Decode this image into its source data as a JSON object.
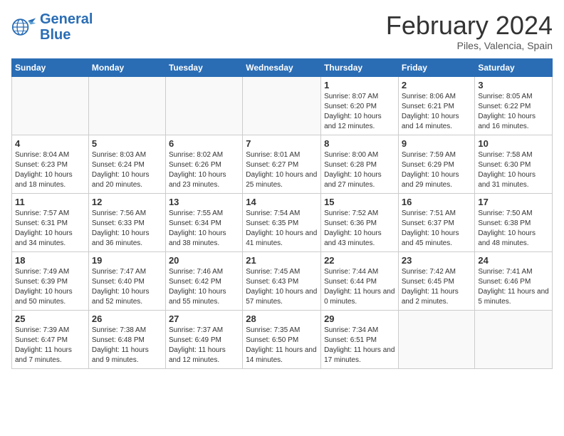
{
  "header": {
    "logo_line1": "General",
    "logo_line2": "Blue",
    "title": "February 2024",
    "subtitle": "Piles, Valencia, Spain"
  },
  "weekdays": [
    "Sunday",
    "Monday",
    "Tuesday",
    "Wednesday",
    "Thursday",
    "Friday",
    "Saturday"
  ],
  "weeks": [
    [
      {
        "day": "",
        "info": ""
      },
      {
        "day": "",
        "info": ""
      },
      {
        "day": "",
        "info": ""
      },
      {
        "day": "",
        "info": ""
      },
      {
        "day": "1",
        "info": "Sunrise: 8:07 AM\nSunset: 6:20 PM\nDaylight: 10 hours\nand 12 minutes."
      },
      {
        "day": "2",
        "info": "Sunrise: 8:06 AM\nSunset: 6:21 PM\nDaylight: 10 hours\nand 14 minutes."
      },
      {
        "day": "3",
        "info": "Sunrise: 8:05 AM\nSunset: 6:22 PM\nDaylight: 10 hours\nand 16 minutes."
      }
    ],
    [
      {
        "day": "4",
        "info": "Sunrise: 8:04 AM\nSunset: 6:23 PM\nDaylight: 10 hours\nand 18 minutes."
      },
      {
        "day": "5",
        "info": "Sunrise: 8:03 AM\nSunset: 6:24 PM\nDaylight: 10 hours\nand 20 minutes."
      },
      {
        "day": "6",
        "info": "Sunrise: 8:02 AM\nSunset: 6:26 PM\nDaylight: 10 hours\nand 23 minutes."
      },
      {
        "day": "7",
        "info": "Sunrise: 8:01 AM\nSunset: 6:27 PM\nDaylight: 10 hours\nand 25 minutes."
      },
      {
        "day": "8",
        "info": "Sunrise: 8:00 AM\nSunset: 6:28 PM\nDaylight: 10 hours\nand 27 minutes."
      },
      {
        "day": "9",
        "info": "Sunrise: 7:59 AM\nSunset: 6:29 PM\nDaylight: 10 hours\nand 29 minutes."
      },
      {
        "day": "10",
        "info": "Sunrise: 7:58 AM\nSunset: 6:30 PM\nDaylight: 10 hours\nand 31 minutes."
      }
    ],
    [
      {
        "day": "11",
        "info": "Sunrise: 7:57 AM\nSunset: 6:31 PM\nDaylight: 10 hours\nand 34 minutes."
      },
      {
        "day": "12",
        "info": "Sunrise: 7:56 AM\nSunset: 6:33 PM\nDaylight: 10 hours\nand 36 minutes."
      },
      {
        "day": "13",
        "info": "Sunrise: 7:55 AM\nSunset: 6:34 PM\nDaylight: 10 hours\nand 38 minutes."
      },
      {
        "day": "14",
        "info": "Sunrise: 7:54 AM\nSunset: 6:35 PM\nDaylight: 10 hours\nand 41 minutes."
      },
      {
        "day": "15",
        "info": "Sunrise: 7:52 AM\nSunset: 6:36 PM\nDaylight: 10 hours\nand 43 minutes."
      },
      {
        "day": "16",
        "info": "Sunrise: 7:51 AM\nSunset: 6:37 PM\nDaylight: 10 hours\nand 45 minutes."
      },
      {
        "day": "17",
        "info": "Sunrise: 7:50 AM\nSunset: 6:38 PM\nDaylight: 10 hours\nand 48 minutes."
      }
    ],
    [
      {
        "day": "18",
        "info": "Sunrise: 7:49 AM\nSunset: 6:39 PM\nDaylight: 10 hours\nand 50 minutes."
      },
      {
        "day": "19",
        "info": "Sunrise: 7:47 AM\nSunset: 6:40 PM\nDaylight: 10 hours\nand 52 minutes."
      },
      {
        "day": "20",
        "info": "Sunrise: 7:46 AM\nSunset: 6:42 PM\nDaylight: 10 hours\nand 55 minutes."
      },
      {
        "day": "21",
        "info": "Sunrise: 7:45 AM\nSunset: 6:43 PM\nDaylight: 10 hours\nand 57 minutes."
      },
      {
        "day": "22",
        "info": "Sunrise: 7:44 AM\nSunset: 6:44 PM\nDaylight: 11 hours\nand 0 minutes."
      },
      {
        "day": "23",
        "info": "Sunrise: 7:42 AM\nSunset: 6:45 PM\nDaylight: 11 hours\nand 2 minutes."
      },
      {
        "day": "24",
        "info": "Sunrise: 7:41 AM\nSunset: 6:46 PM\nDaylight: 11 hours\nand 5 minutes."
      }
    ],
    [
      {
        "day": "25",
        "info": "Sunrise: 7:39 AM\nSunset: 6:47 PM\nDaylight: 11 hours\nand 7 minutes."
      },
      {
        "day": "26",
        "info": "Sunrise: 7:38 AM\nSunset: 6:48 PM\nDaylight: 11 hours\nand 9 minutes."
      },
      {
        "day": "27",
        "info": "Sunrise: 7:37 AM\nSunset: 6:49 PM\nDaylight: 11 hours\nand 12 minutes."
      },
      {
        "day": "28",
        "info": "Sunrise: 7:35 AM\nSunset: 6:50 PM\nDaylight: 11 hours\nand 14 minutes."
      },
      {
        "day": "29",
        "info": "Sunrise: 7:34 AM\nSunset: 6:51 PM\nDaylight: 11 hours\nand 17 minutes."
      },
      {
        "day": "",
        "info": ""
      },
      {
        "day": "",
        "info": ""
      }
    ]
  ]
}
